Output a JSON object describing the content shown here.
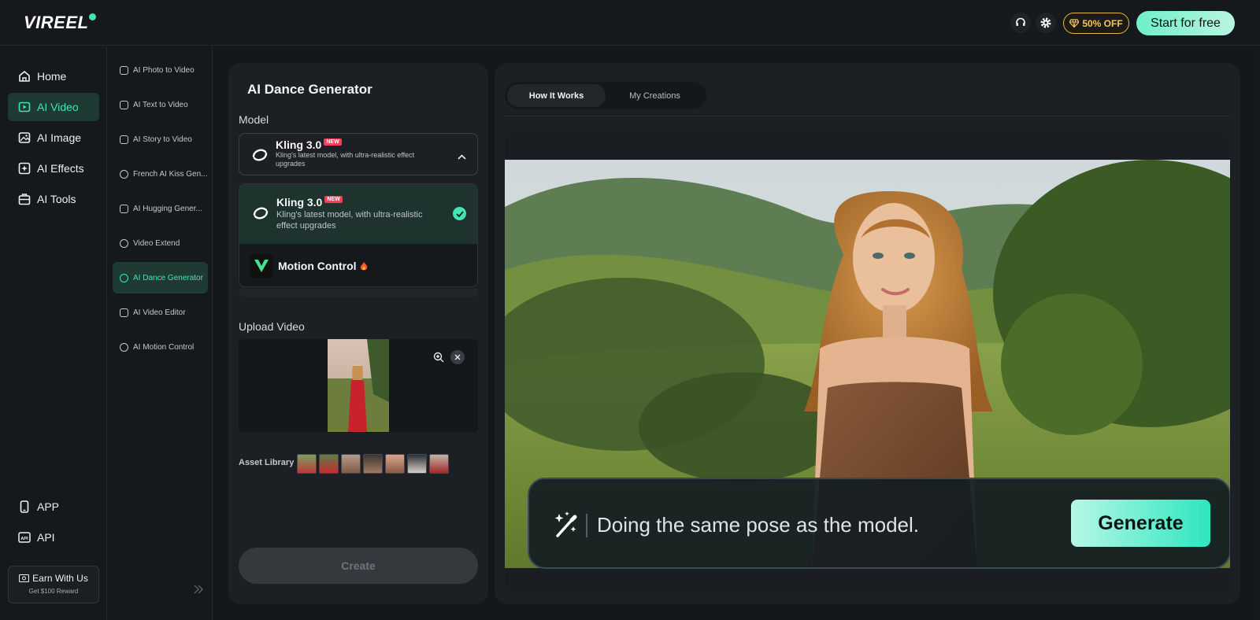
{
  "header": {
    "logo_text": "VIREEL",
    "promo_label": "50% OFF",
    "start_label": "Start for free"
  },
  "nav": {
    "items": [
      {
        "label": "Home",
        "icon": "home-icon"
      },
      {
        "label": "AI Video",
        "icon": "video-icon",
        "active": true
      },
      {
        "label": "AI Image",
        "icon": "image-icon"
      },
      {
        "label": "AI Effects",
        "icon": "effects-icon"
      },
      {
        "label": "AI Tools",
        "icon": "toolbox-icon"
      }
    ],
    "bottom": [
      {
        "label": "APP",
        "icon": "phone-icon"
      },
      {
        "label": "API",
        "icon": "api-icon"
      }
    ],
    "earn_title": "Earn With Us",
    "earn_sub": "Get $100 Reward"
  },
  "subnav": {
    "items": [
      {
        "label": "AI Photo to Video"
      },
      {
        "label": "AI Text to Video"
      },
      {
        "label": "AI Story to Video"
      },
      {
        "label": "French AI Kiss Gen..."
      },
      {
        "label": "AI Hugging Gener..."
      },
      {
        "label": "Video Extend"
      },
      {
        "label": "AI Dance Generator",
        "active": true
      },
      {
        "label": "AI Video Editor"
      },
      {
        "label": "AI Motion Control"
      }
    ]
  },
  "form": {
    "title": "AI Dance Generator",
    "model_label": "Model",
    "selected_model": {
      "name": "Kling 3.0",
      "badge": "NEW",
      "desc": "Kling's latest model, with ultra-realistic effect upgrades"
    },
    "options": [
      {
        "name": "Kling 3.0",
        "badge": "NEW",
        "desc": "Kling's latest model, with ultra-realistic effect upgrades",
        "selected": true
      },
      {
        "name": "Motion Control",
        "badge_icon": "fire-icon"
      }
    ],
    "upload_label": "Upload Video",
    "asset_label": "Asset Library",
    "create_label": "Create"
  },
  "preview": {
    "tabs": [
      {
        "label": "How It Works",
        "active": true
      },
      {
        "label": "My Creations"
      }
    ],
    "prompt_text": "Doing the same pose as the model.",
    "generate_label": "Generate"
  },
  "colors": {
    "accent": "#3ee6b2",
    "bg": "#14171b",
    "panel": "#1c1f23",
    "promo": "#f3c561"
  }
}
